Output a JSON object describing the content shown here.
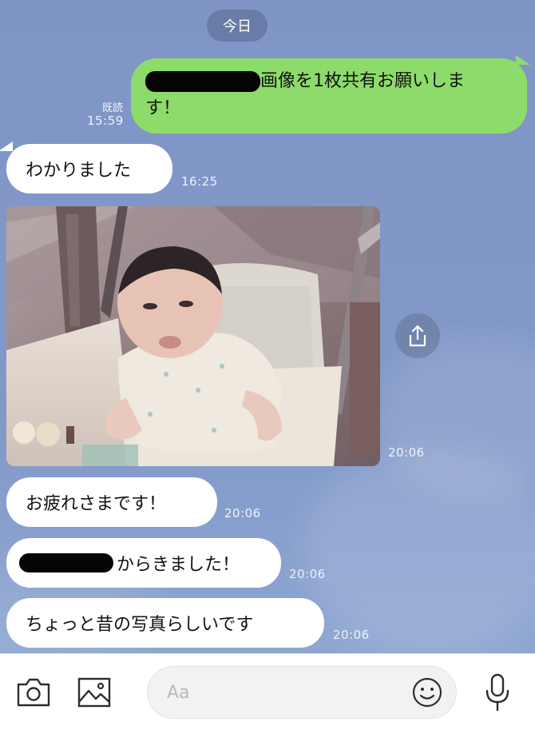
{
  "chat": {
    "date_label": "今日",
    "messages": [
      {
        "id": "m1",
        "direction": "outgoing",
        "redacted_prefix": true,
        "line1": "画像を1枚共有お願いしま",
        "line2": "す！",
        "read_label": "既読",
        "time": "15:59"
      },
      {
        "id": "m2",
        "direction": "incoming",
        "text": "わかりました",
        "time": "16:25"
      },
      {
        "id": "m3",
        "direction": "incoming",
        "type": "image",
        "description": "old photo of a baby in a stroller",
        "time": "20:06"
      },
      {
        "id": "m4",
        "direction": "incoming",
        "text": "お疲れさまです！",
        "time": "20:06"
      },
      {
        "id": "m5",
        "direction": "incoming",
        "redacted_prefix": true,
        "text": "からきました！",
        "time": "20:06"
      },
      {
        "id": "m6",
        "direction": "incoming",
        "text": "ちょっと昔の写真らしいです",
        "time": "20:06"
      }
    ]
  },
  "input_bar": {
    "placeholder": "Aa",
    "icons": [
      "camera-icon",
      "image-icon",
      "emoji-icon",
      "microphone-icon"
    ]
  },
  "colors": {
    "background": "#8299c8",
    "outgoing_bubble": "#8ddb6b",
    "incoming_bubble": "#ffffff"
  }
}
